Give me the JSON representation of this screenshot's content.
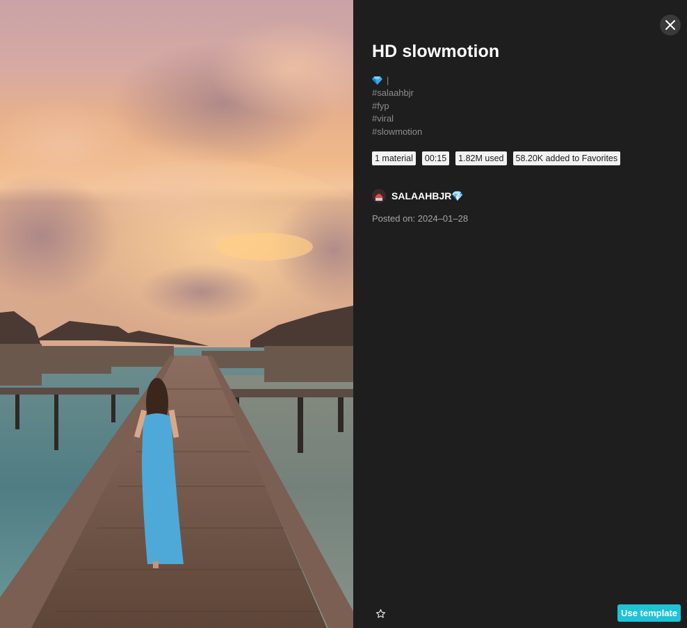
{
  "template": {
    "title": "HD slowmotion",
    "description_lines": [
      "|",
      "#salaahbjr",
      "#fyp",
      "#viral",
      "#slowmotion"
    ]
  },
  "stats": {
    "materials": "1 material",
    "duration": "00:15",
    "used": "1.82M used",
    "favorites": "58.20K added to Favorites"
  },
  "author": {
    "name": "SALAAHBJR💎",
    "posted": "Posted on: 2024–01–28"
  },
  "actions": {
    "use_template": "Use template"
  },
  "icons": {
    "gem": "gem-icon",
    "close": "close-icon",
    "favorite": "star-icon",
    "avatar": "avatar-icon"
  },
  "colors": {
    "accent": "#1ec3d6",
    "panel_bg": "#1e1e1e",
    "muted_text": "#8d8d8d"
  }
}
